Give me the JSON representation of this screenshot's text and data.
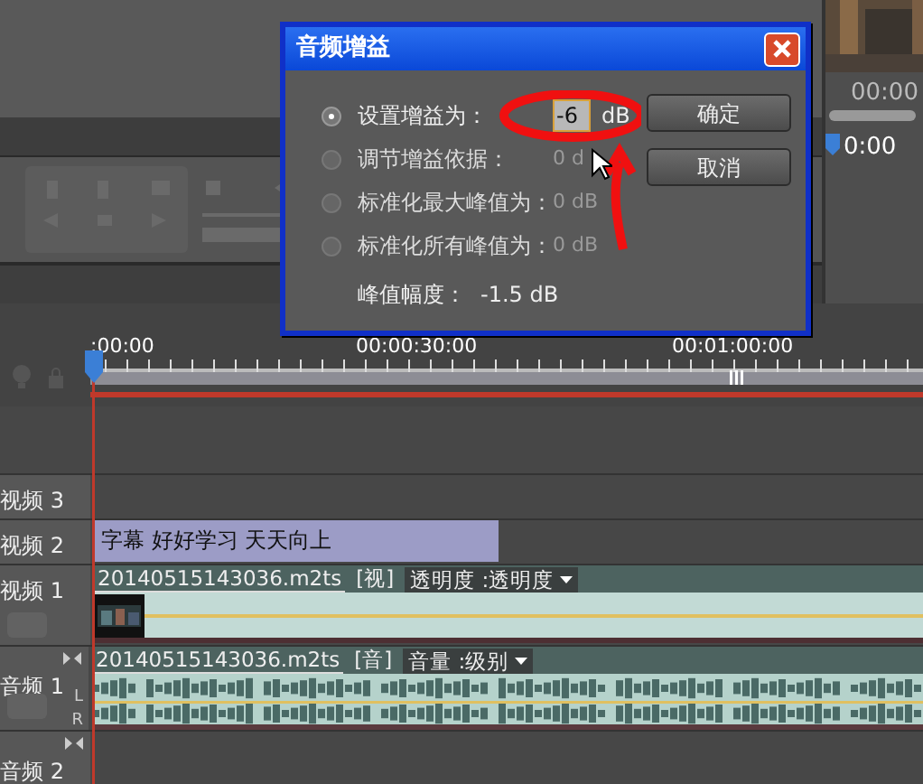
{
  "monitor": {
    "timecode": "00:00",
    "timecode_2": "0:00"
  },
  "timeline": {
    "ruler": [
      ":00:00",
      "00:00:30:00",
      "00:01:00:00"
    ],
    "tracks": [
      {
        "name": "视频 3",
        "kind": "empty"
      },
      {
        "name": "视频 2",
        "kind": "title",
        "clip": "字幕 好好学习 天天向上"
      },
      {
        "name": "视频 1",
        "kind": "video",
        "clip": "20140515143036.m2ts",
        "tag": "[视]",
        "effect": "透明度 :透明度"
      },
      {
        "name": "音频 1",
        "kind": "audio",
        "clip": "20140515143036.m2ts",
        "tag": "[音]",
        "effect": "音量 :级别",
        "channels": [
          "L",
          "R"
        ]
      },
      {
        "name": "音频 2",
        "kind": "audio-empty"
      }
    ]
  },
  "dialog": {
    "title": "音频增益",
    "options": [
      {
        "label": "设置增益为：",
        "selected": true,
        "disabled": false,
        "value": "-6",
        "unit": "dB"
      },
      {
        "label": "调节增益依据：",
        "selected": false,
        "disabled": true,
        "value": "0 d"
      },
      {
        "label": "标准化最大峰值为：",
        "selected": false,
        "disabled": true,
        "value": "0 dB"
      },
      {
        "label": "标准化所有峰值为：",
        "selected": false,
        "disabled": true,
        "value": "0 dB"
      }
    ],
    "peak_label": "峰值幅度：",
    "peak_value": "-1.5 dB",
    "buttons": [
      "确定",
      "取消"
    ]
  }
}
